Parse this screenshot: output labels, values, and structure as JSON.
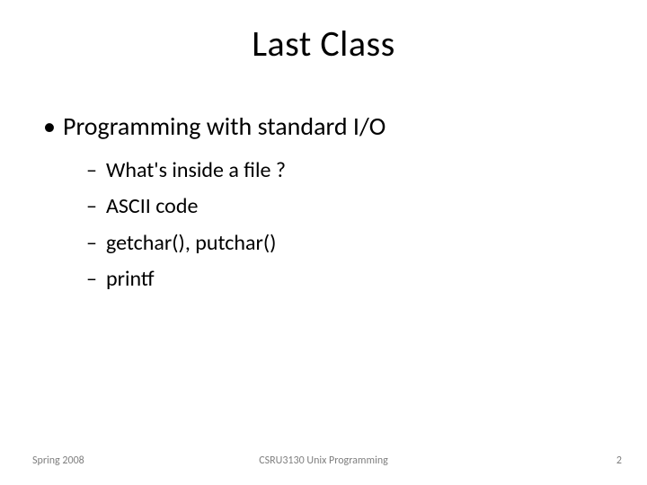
{
  "title": "Last Class",
  "bullets": {
    "l1": "Programming with standard I/O",
    "l2": [
      "What's inside a file ?",
      "ASCII code",
      "getchar(), putchar()",
      "printf"
    ]
  },
  "footer": {
    "left": "Spring 2008",
    "center": "CSRU3130 Unix Programming",
    "right": "2"
  }
}
